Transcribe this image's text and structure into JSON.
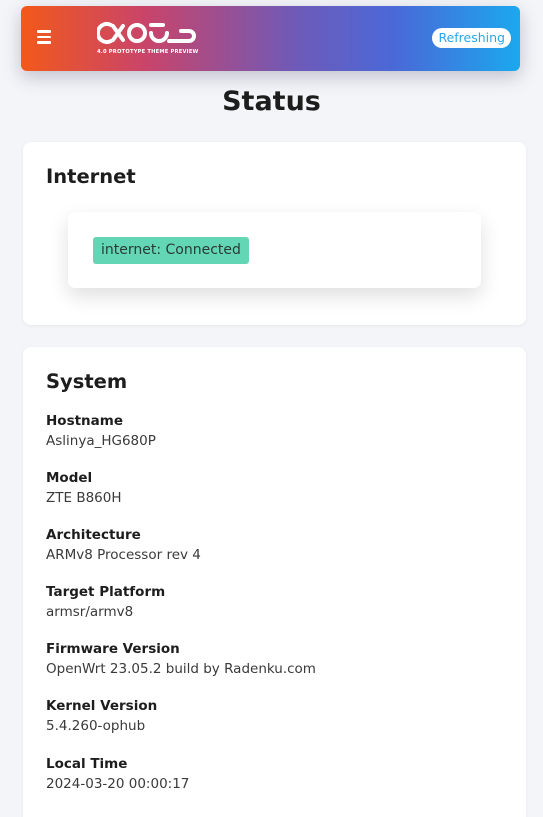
{
  "header": {
    "logo_subtitle": "4.0 PROTOTYPE THEME PREVIEW",
    "refresh_badge": "Refreshing",
    "menu_icon": "hamburger-icon",
    "accent_color": "#2aa7e6"
  },
  "page": {
    "title": "Status"
  },
  "internet": {
    "title": "Internet",
    "status": "internet: Connected",
    "status_color": "#63d7b5"
  },
  "system": {
    "title": "System",
    "fields": [
      {
        "label": "Hostname",
        "value": "Aslinya_HG680P"
      },
      {
        "label": "Model",
        "value": "ZTE B860H"
      },
      {
        "label": "Architecture",
        "value": "ARMv8 Processor rev 4"
      },
      {
        "label": "Target Platform",
        "value": "armsr/armv8"
      },
      {
        "label": "Firmware Version",
        "value": "OpenWrt 23.05.2 build by Radenku.com"
      },
      {
        "label": "Kernel Version",
        "value": "5.4.260-ophub"
      },
      {
        "label": "Local Time",
        "value": "2024-03-20 00:00:17"
      }
    ]
  }
}
